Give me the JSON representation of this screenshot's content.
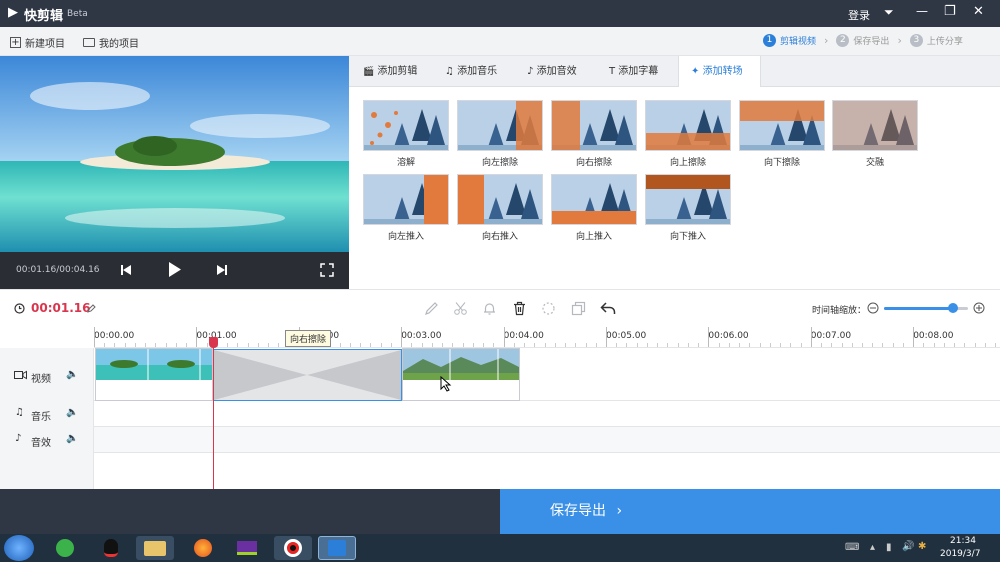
{
  "app": {
    "logo_glyph": "▶",
    "name": "快剪辑",
    "badge": "Beta"
  },
  "titlebar": {
    "login": "登录",
    "menu_glyph": "⏷",
    "min_glyph": "—",
    "max_glyph": "❐",
    "close_glyph": "✕"
  },
  "toolbar": {
    "new_project": "新建项目",
    "my_projects": "我的项目",
    "steps": [
      {
        "num": "1",
        "label": "剪辑视频"
      },
      {
        "num": "2",
        "label": "保存导出"
      },
      {
        "num": "3",
        "label": "上传分享"
      }
    ],
    "step_sep": "›"
  },
  "preview": {
    "time": "00:01.16/00:04.16"
  },
  "tabs": [
    {
      "icon": "🎬",
      "label": "添加剪辑"
    },
    {
      "icon": "♫",
      "label": "添加音乐"
    },
    {
      "icon": "♪",
      "label": "添加音效"
    },
    {
      "icon": "T",
      "label": "添加字幕"
    },
    {
      "icon": "✦",
      "label": "添加转场"
    }
  ],
  "transitions": [
    {
      "label": "溶解"
    },
    {
      "label": "向左擦除"
    },
    {
      "label": "向右擦除"
    },
    {
      "label": "向上擦除"
    },
    {
      "label": "向下擦除"
    },
    {
      "label": "交融"
    },
    {
      "label": "向左推入"
    },
    {
      "label": "向右推入"
    },
    {
      "label": "向上推入"
    },
    {
      "label": "向下推入"
    }
  ],
  "timeline": {
    "current_time": "00:01.16",
    "zoom_label": "时间轴缩放：",
    "zoom_level": 0.82,
    "ticks": [
      "00:00.00",
      "00:01.00",
      "00:02.00",
      "00:03.00",
      "00:04.00",
      "00:05.00",
      "00:06.00",
      "00:07.00",
      "00:08.00"
    ],
    "tooltip": "向右擦除",
    "tracks": [
      {
        "label": "视频"
      },
      {
        "label": "音乐"
      },
      {
        "label": "音效"
      }
    ]
  },
  "export": {
    "label": "保存导出",
    "chevron": "›"
  },
  "taskbar": {
    "time": "21:34",
    "date": "2019/3/7"
  },
  "colors": {
    "accent": "#2b7fd9",
    "export_bg": "#3a8fe6",
    "titlebar": "#2f3644",
    "playhead": "#d9364e",
    "time_red": "#d9364e"
  }
}
